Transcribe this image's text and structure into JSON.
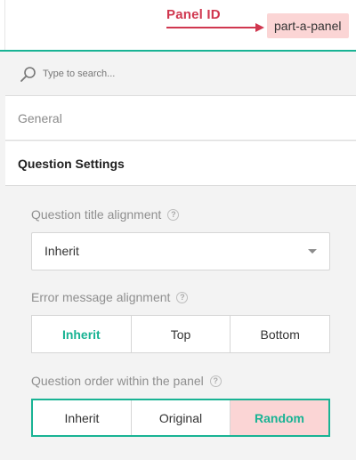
{
  "annotation": {
    "label": "Panel ID",
    "chip": "part-a-panel",
    "label_color": "#d0374f",
    "chip_color": "#fbd5d5"
  },
  "search": {
    "placeholder": "Type to search..."
  },
  "categories": [
    {
      "label": "General"
    },
    {
      "label": "Question Settings"
    }
  ],
  "fields": {
    "title_alignment": {
      "label": "Question title alignment",
      "value": "Inherit"
    },
    "error_alignment": {
      "label": "Error message alignment",
      "options": [
        "Inherit",
        "Top",
        "Bottom"
      ],
      "selected": "Inherit"
    },
    "question_order": {
      "label": "Question order within the panel",
      "options": [
        "Inherit",
        "Original",
        "Random"
      ],
      "selected": "Random"
    }
  },
  "help_glyph": "?",
  "accent_color": "#19b394"
}
